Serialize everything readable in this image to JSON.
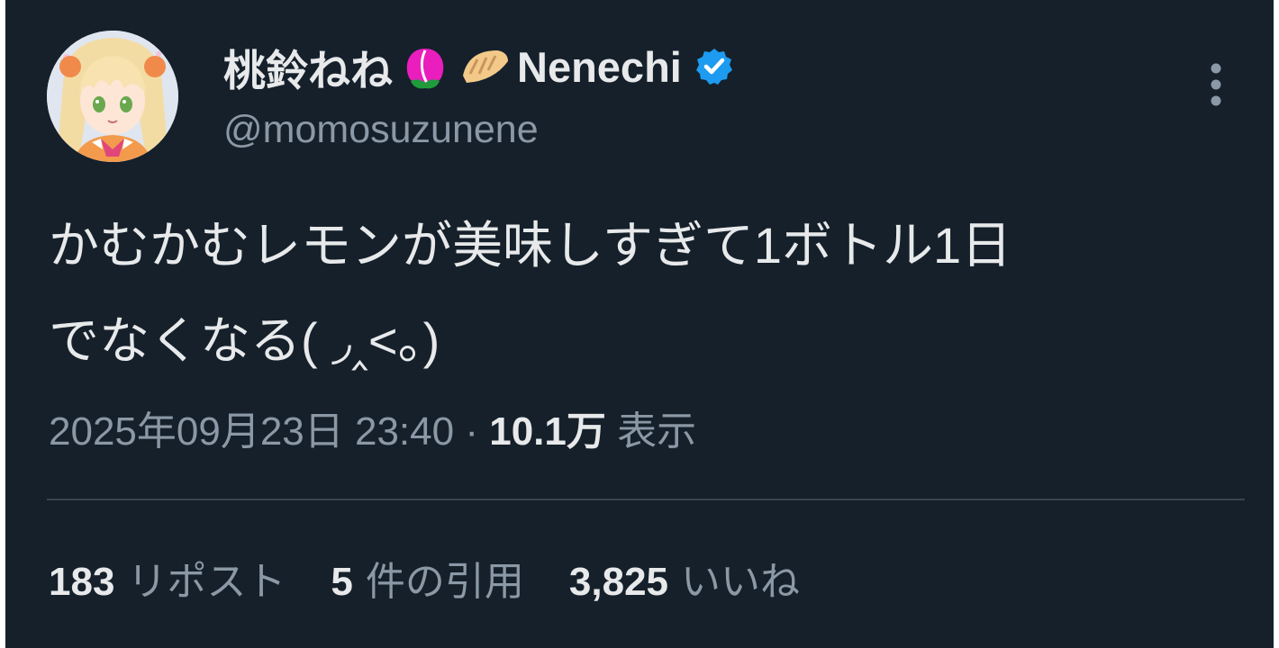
{
  "author": {
    "display_name": "桃鈴ねね",
    "display_name_suffix": "Nenechi",
    "handle": "@momosuzunene",
    "verified": true,
    "name_emojis": [
      "peach-emoji",
      "dumpling-emoji"
    ]
  },
  "tweet": {
    "text_line1": "かむかむレモンが美味しすぎて1ボトル1日",
    "text_line2": "でなくなる( ◞‸<。)",
    "timestamp": "2025年09月23日 23:40",
    "separator": " · ",
    "views_count": "10.1万",
    "views_label": "表示"
  },
  "stats": {
    "reposts_count": "183",
    "reposts_label": "リポスト",
    "quotes_count": "5",
    "quotes_label": "件の引用",
    "likes_count": "3,825",
    "likes_label": "いいね"
  },
  "icons": {
    "more": "more-vertical-icon",
    "verified": "verified-badge-icon"
  },
  "colors": {
    "background": "#15202b",
    "text_primary": "#e7e9ea",
    "text_secondary": "#8b98a5",
    "divider": "#38444d",
    "verified_blue": "#1d9bf0"
  }
}
